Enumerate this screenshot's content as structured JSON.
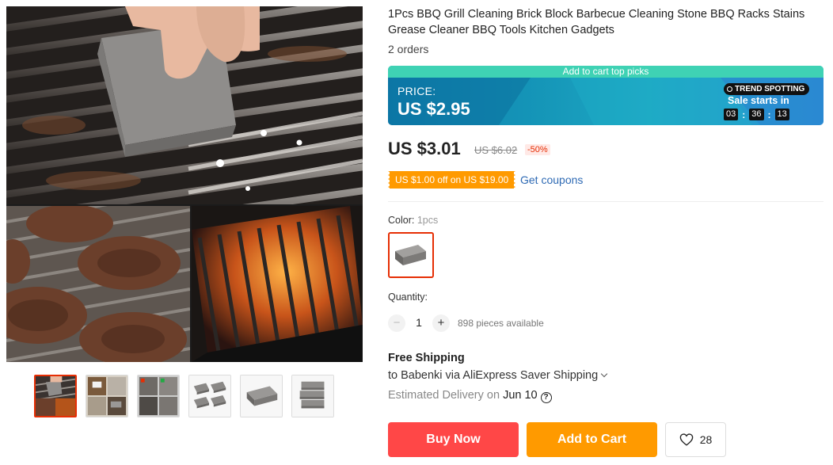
{
  "product": {
    "title": "1Pcs BBQ Grill Cleaning Brick Block Barbecue Cleaning Stone BBQ Racks Stains Grease Cleaner BBQ Tools Kitchen Gadgets",
    "orders": "2 orders"
  },
  "gallery": {
    "main_images": [
      "grill-cleaning-block-photo",
      "burger-patties-grill-photo",
      "hot-grill-grate-photo"
    ],
    "thumbnails": [
      {
        "icon": "thumb-grill-cleaning",
        "active": true
      },
      {
        "icon": "thumb-collage",
        "active": false
      },
      {
        "icon": "thumb-usage-steps",
        "active": false
      },
      {
        "icon": "thumb-four-blocks",
        "active": false
      },
      {
        "icon": "thumb-single-block",
        "active": false
      },
      {
        "icon": "thumb-stacked-blocks",
        "active": false
      }
    ]
  },
  "banner": {
    "top_text": "Add to cart top picks",
    "price_label": "PRICE:",
    "price": "US $2.95",
    "badge": "TREND SPOTTING",
    "sale_text": "Sale starts in",
    "countdown": [
      "03",
      "36",
      "13"
    ],
    "colors": {
      "top_strip": "#3fd2b4",
      "base": "#1596b8"
    }
  },
  "pricing": {
    "current": "US $3.01",
    "original": "US $6.02",
    "discount": "-50%"
  },
  "coupon": {
    "label": "US $1.00 off on US $19.00",
    "link": "Get coupons"
  },
  "color": {
    "label": "Color: ",
    "value": "1pcs"
  },
  "quantity": {
    "label": "Quantity:",
    "minus": "−",
    "value": "1",
    "plus": "+",
    "available": "898 pieces available"
  },
  "shipping": {
    "title": "Free Shipping",
    "destination": "to Babenki via AliExpress Saver Shipping",
    "delivery_prefix": "Estimated Delivery on ",
    "delivery_date": "Jun 10",
    "help": "?"
  },
  "actions": {
    "buy_now": "Buy Now",
    "add_to_cart": "Add to Cart",
    "wishlist_count": "28"
  },
  "colors": {
    "accent_red": "#ff4747",
    "accent_orange": "#ff9a00",
    "link_blue": "#2e6ab4",
    "selected_border": "#e62e04"
  }
}
